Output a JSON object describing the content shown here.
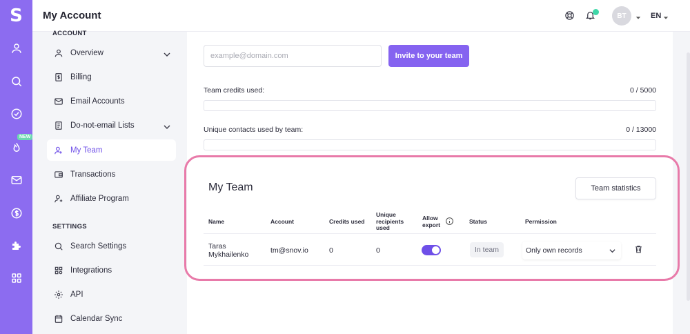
{
  "app": {
    "logo_letter": "S",
    "title": "My Account",
    "avatar_initials": "BT",
    "language": "EN",
    "new_badge": "NEW",
    "rail_icons": [
      "user-icon",
      "search-icon",
      "check-circle-icon",
      "flame-icon",
      "mail-icon",
      "dollar-icon",
      "puzzle-icon",
      "grid-icon"
    ]
  },
  "sidebar": {
    "account_title": "ACCOUNT",
    "settings_title": "SETTINGS",
    "account_items": [
      {
        "label": "Overview",
        "icon": "user-icon"
      },
      {
        "label": "Billing",
        "icon": "billing-icon"
      },
      {
        "label": "Email Accounts",
        "icon": "mail-icon"
      },
      {
        "label": "Do-not-email Lists",
        "icon": "list-icon"
      },
      {
        "label": "My Team",
        "icon": "team-icon",
        "active": true
      },
      {
        "label": "Transactions",
        "icon": "wallet-icon"
      },
      {
        "label": "Affiliate Program",
        "icon": "affiliate-icon"
      }
    ],
    "settings_items": [
      {
        "label": "Search Settings",
        "icon": "search-icon"
      },
      {
        "label": "Integrations",
        "icon": "integrations-icon"
      },
      {
        "label": "API",
        "icon": "gear-icon"
      },
      {
        "label": "Calendar Sync",
        "icon": "calendar-icon"
      }
    ]
  },
  "invite": {
    "placeholder": "example@domain.com",
    "button_label": "Invite to your team"
  },
  "usage": {
    "credits_label": "Team credits used:",
    "credits_value": "0 / 5000",
    "credits_used": 0,
    "credits_total": 5000,
    "contacts_label": "Unique contacts used by team:",
    "contacts_value": "0 / 13000",
    "contacts_used": 0,
    "contacts_total": 13000
  },
  "team": {
    "title": "My Team",
    "stats_button": "Team statistics",
    "columns": {
      "name": "Name",
      "account": "Account",
      "credits": "Credits used",
      "unique_1": "Unique",
      "unique_2": "recipients",
      "unique_3": "used",
      "allow_1": "Allow",
      "allow_2": "export",
      "status": "Status",
      "permission": "Permission"
    },
    "members": [
      {
        "name_1": "Taras",
        "name_2": "Mykhailenko",
        "account": "tm@snov.io",
        "credits_used": "0",
        "unique_recipients": "0",
        "allow_export": true,
        "status": "In team",
        "permission": "Only own records"
      }
    ]
  },
  "colors": {
    "rail": "#8c6cf0",
    "accent": "#8563f0",
    "highlight": "#e87aa9",
    "notification": "#3fd7a8"
  }
}
